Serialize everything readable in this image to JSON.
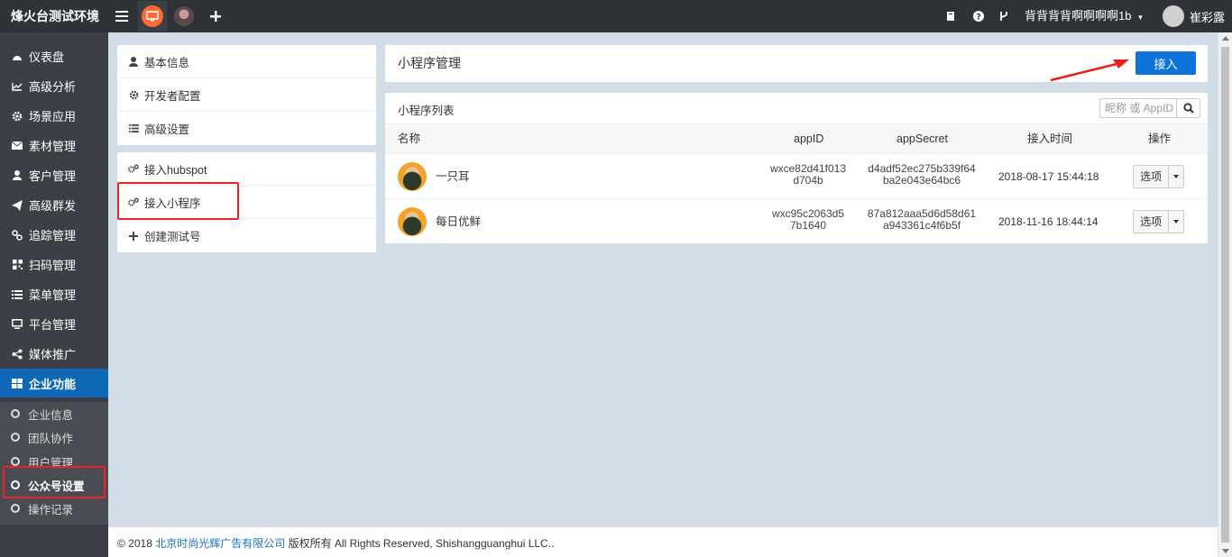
{
  "topbar": {
    "brand": "烽火台测试环境",
    "account": "背背背背啊啊啊啊1b",
    "account_caret": "▾",
    "user_name": "崔彩露",
    "icons": [
      "menu-icon",
      "app-logo-icon",
      "avatar-icon",
      "plus-icon",
      "book-icon",
      "help-icon",
      "fork-icon"
    ]
  },
  "sidebar": {
    "items": [
      {
        "label": "仪表盘",
        "icon": "dashboard-icon"
      },
      {
        "label": "高级分析",
        "icon": "line-chart-icon"
      },
      {
        "label": "场景应用",
        "icon": "gear-icon"
      },
      {
        "label": "素材管理",
        "icon": "envelope-icon"
      },
      {
        "label": "客户管理",
        "icon": "user-icon"
      },
      {
        "label": "高级群发",
        "icon": "paper-plane-icon"
      },
      {
        "label": "追踪管理",
        "icon": "link-icon"
      },
      {
        "label": "扫码管理",
        "icon": "qrcode-icon"
      },
      {
        "label": "菜单管理",
        "icon": "list-icon"
      },
      {
        "label": "平台管理",
        "icon": "desktop-icon"
      },
      {
        "label": "媒体推广",
        "icon": "share-icon"
      },
      {
        "label": "企业功能",
        "icon": "grid-icon"
      }
    ],
    "sub_items": [
      {
        "label": "企业信息"
      },
      {
        "label": "团队协作"
      },
      {
        "label": "用户管理"
      },
      {
        "label": "公众号设置"
      },
      {
        "label": "操作记录"
      }
    ],
    "colors": {
      "active_bg": "#0f67b8",
      "bg": "#3c4046"
    }
  },
  "midnav": {
    "group1": [
      {
        "label": "基本信息",
        "icon": "user-icon"
      },
      {
        "label": "开发者配置",
        "icon": "gear-icon"
      },
      {
        "label": "高级设置",
        "icon": "list-icon"
      }
    ],
    "group2": [
      {
        "label": "接入hubspot",
        "icon": "gears-icon"
      },
      {
        "label": "接入小程序",
        "icon": "gears-icon"
      },
      {
        "label": "创建测试号",
        "icon": "plus-icon"
      }
    ]
  },
  "main": {
    "title": "小程序管理",
    "connect_button": "接入",
    "list_title": "小程序列表",
    "search_placeholder": "昵称 或 AppID",
    "columns": [
      "名称",
      "appID",
      "appSecret",
      "接入时间",
      "操作"
    ],
    "rows": [
      {
        "name": "一只耳",
        "appid_1": "wxce82d41f013",
        "appid_2": "d704b",
        "secret_1": "d4adf52ec275b339f64",
        "secret_2": "ba2e043e64bc6",
        "time": "2018-08-17 15:44:18",
        "option": "选项"
      },
      {
        "name": "每日优鲜",
        "appid_1": "wxc95c2063d5",
        "appid_2": "7b1640",
        "secret_1": "87a812aaa5d6d58d61",
        "secret_2": "a943361c4f6b5f",
        "time": "2018-11-16 18:44:14",
        "option": "选项"
      }
    ],
    "accent_color": "#0f74d9"
  },
  "footer": {
    "prefix": "© 2018 ",
    "company": "北京时尚光辉广告有限公司",
    "suffix": " 版权所有 All Rights Reserved, Shishangguanghui LLC.."
  }
}
